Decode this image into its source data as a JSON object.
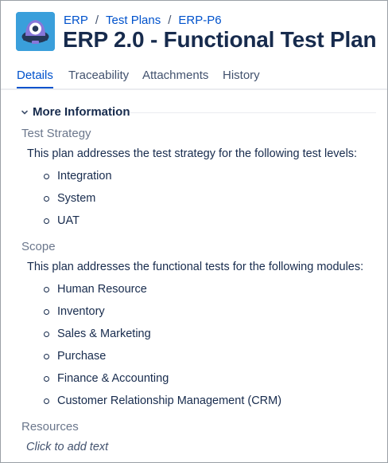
{
  "breadcrumb": {
    "items": [
      "ERP",
      "Test Plans",
      "ERP-P6"
    ],
    "separator": "/"
  },
  "header": {
    "title": "ERP 2.0 - Functional Test Plan",
    "avatar_icon": "project-avatar-icon"
  },
  "tabs": [
    {
      "label": "Details",
      "active": true
    },
    {
      "label": "Traceability",
      "active": false
    },
    {
      "label": "Attachments",
      "active": false
    },
    {
      "label": "History",
      "active": false
    }
  ],
  "more_info": {
    "heading": "More Information",
    "expanded": true,
    "test_strategy": {
      "label": "Test Strategy",
      "intro": "This plan addresses the test strategy for the following test levels:",
      "items": [
        "Integration",
        "System",
        "UAT"
      ]
    },
    "scope": {
      "label": "Scope",
      "intro": "This plan addresses the functional tests for the following modules:",
      "items": [
        "Human Resource",
        "Inventory",
        "Sales & Marketing",
        "Purchase",
        "Finance & Accounting",
        "Customer Relationship Management (CRM)"
      ]
    },
    "resources": {
      "label": "Resources",
      "placeholder": "Click to add text"
    }
  },
  "colors": {
    "link": "#0052cc",
    "text": "#172b4d",
    "muted": "#6b778c",
    "avatar_bg": "#3a9fdb"
  }
}
